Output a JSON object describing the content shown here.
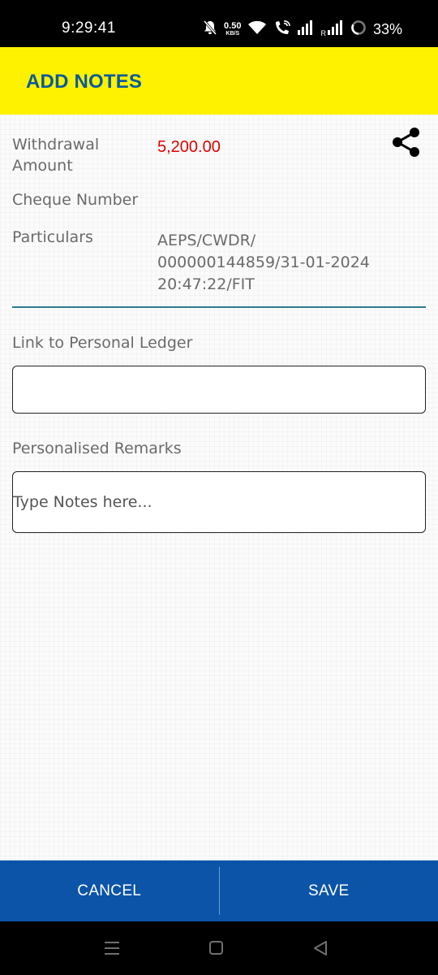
{
  "status_bar": {
    "time": "9:29:41",
    "net_speed_value": "0.50",
    "net_speed_unit": "KB/S",
    "roaming_label": "R",
    "battery_percent": "33%",
    "icons": [
      "mute-bell-icon",
      "wifi-icon",
      "wifi-call-icon",
      "signal-icon",
      "signal-roaming-icon",
      "battery-ring-icon"
    ]
  },
  "app_bar": {
    "title": "ADD NOTES",
    "background": "#fff200",
    "title_color": "#0a5a9c"
  },
  "transaction": {
    "withdrawal_label_line1": "Withdrawal",
    "withdrawal_label_line2": "Amount",
    "withdrawal_amount": "5,200.00",
    "amount_color": "#e00000",
    "cheque_label": "Cheque Number",
    "cheque_value": "",
    "particulars_label": "Particulars",
    "particulars_line1": "AEPS/CWDR/",
    "particulars_line2": "000000144859/31-01-2024",
    "particulars_line3": "20:47:22/FIT",
    "share_icon": "share-icon"
  },
  "form": {
    "ledger_label": "Link to Personal Ledger",
    "ledger_value": "",
    "remarks_label": "Personalised Remarks",
    "remarks_placeholder": "Type Notes here..."
  },
  "actions": {
    "cancel_label": "CANCEL",
    "save_label": "SAVE",
    "bar_color": "#0b54a8"
  },
  "nav_bar": {
    "icons": [
      "recents-icon",
      "home-icon",
      "back-icon"
    ]
  }
}
